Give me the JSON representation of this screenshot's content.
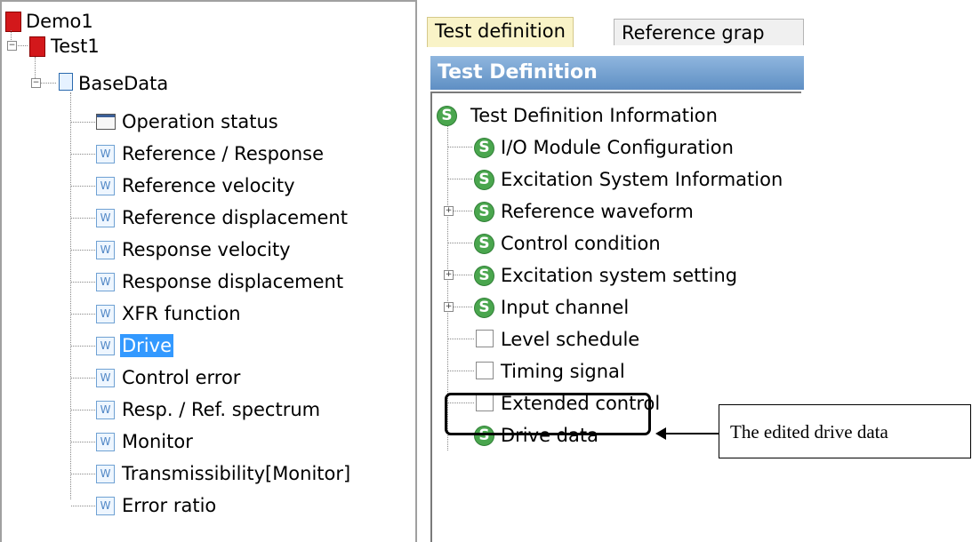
{
  "left_tree": {
    "root": "Demo1",
    "test": "Test1",
    "base": "BaseData",
    "items": [
      "Operation status",
      "Reference / Response",
      "Reference velocity",
      "Reference displacement",
      "Response velocity",
      "Response displacement",
      "XFR function",
      "Drive",
      "Control error",
      "Resp. / Ref. spectrum",
      "Monitor",
      "Transmissibility[Monitor]",
      "Error ratio"
    ],
    "selected": "Drive"
  },
  "tabs": [
    {
      "label": "Test definition",
      "active": true
    },
    {
      "label": "Reference grap",
      "active": false
    }
  ],
  "panel_header": "Test Definition",
  "right_tree": {
    "root": "Test Definition Information",
    "items": [
      {
        "label": "I/O Module Configuration",
        "icon": "s-icon",
        "expandable": false
      },
      {
        "label": "Excitation System Information",
        "icon": "s-icon",
        "expandable": false
      },
      {
        "label": "Reference waveform",
        "icon": "s-icon",
        "expandable": true
      },
      {
        "label": "Control condition",
        "icon": "s-icon",
        "expandable": false
      },
      {
        "label": "Excitation system setting",
        "icon": "s-icon",
        "expandable": true
      },
      {
        "label": "Input channel",
        "icon": "s-icon",
        "expandable": true
      },
      {
        "label": "Level schedule",
        "icon": "checkbox",
        "expandable": false
      },
      {
        "label": "Timing signal",
        "icon": "checkbox",
        "expandable": false
      },
      {
        "label": "Extended control",
        "icon": "checkbox",
        "expandable": false
      },
      {
        "label": "Drive data",
        "icon": "s-icon",
        "expandable": false
      }
    ]
  },
  "callout": "The edited drive data",
  "colors": {
    "selection": "#3399ff",
    "header_gradient_top": "#8fb6de",
    "header_gradient_bottom": "#5f8fc4",
    "active_tab": "#f9f3c7",
    "s_icon": "#4aa64e",
    "root_icon": "#d3181b"
  }
}
